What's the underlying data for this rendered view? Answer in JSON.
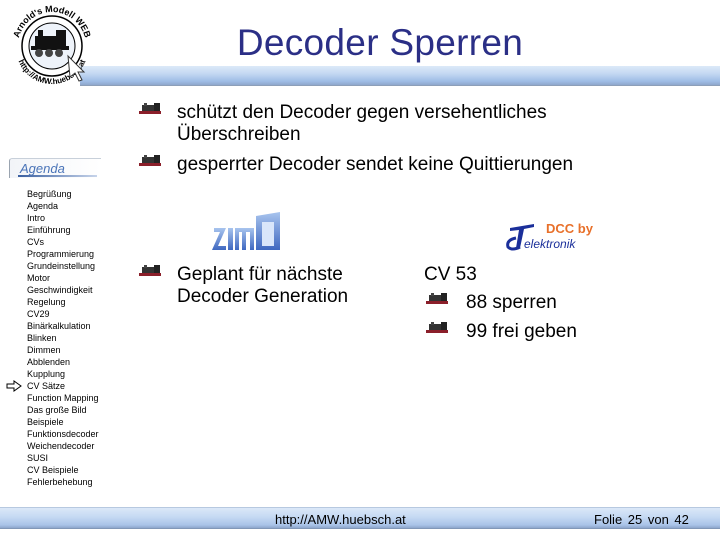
{
  "slide": {
    "title": "Decoder Sperren",
    "logo_text_top": "Arnold's Modell WEB",
    "logo_text_bottom": "http://AMW.huebsch.at"
  },
  "agenda": {
    "header": "Agenda",
    "current_index": 16,
    "items": [
      "Begrüßung",
      "Agenda",
      "Intro",
      "Einführung",
      "CVs",
      "Programmierung",
      "Grundeinstellung",
      "Motor",
      "Geschwindigkeit",
      "Regelung",
      "CV29",
      "Binärkalkulation",
      "Blinken",
      "Dimmen",
      "Abblenden",
      "Kupplung",
      "CV Sätze",
      "Function Mapping",
      "Das große Bild",
      "Beispiele",
      "Funktionsdecoder",
      "Weichendecoder",
      "SUSI",
      "CV Beispiele",
      "Fehlerbehebung"
    ]
  },
  "content": {
    "bullets": [
      "schützt den Decoder gegen versehentliches Überschreiben",
      "gesperrter Decoder sendet keine Quittierungen"
    ],
    "zimo": {
      "logo": "zimo",
      "text": "Geplant für nächste Decoder Generation"
    },
    "dcc": {
      "logo_top": "DCC by",
      "logo_bottom": "elektronik",
      "cv_label": "CV 53",
      "sub_items": [
        "88 sperren",
        "99 frei geben"
      ]
    }
  },
  "footer": {
    "url": "http://AMW.huebsch.at",
    "page": "Folie 25 von 42"
  },
  "colors": {
    "title": "#2b2f86",
    "band": "#c4d8f2",
    "agenda_header": "#4a74b8",
    "dcc_orange": "#e8702a",
    "tlogo_blue": "#1b2f9a"
  }
}
